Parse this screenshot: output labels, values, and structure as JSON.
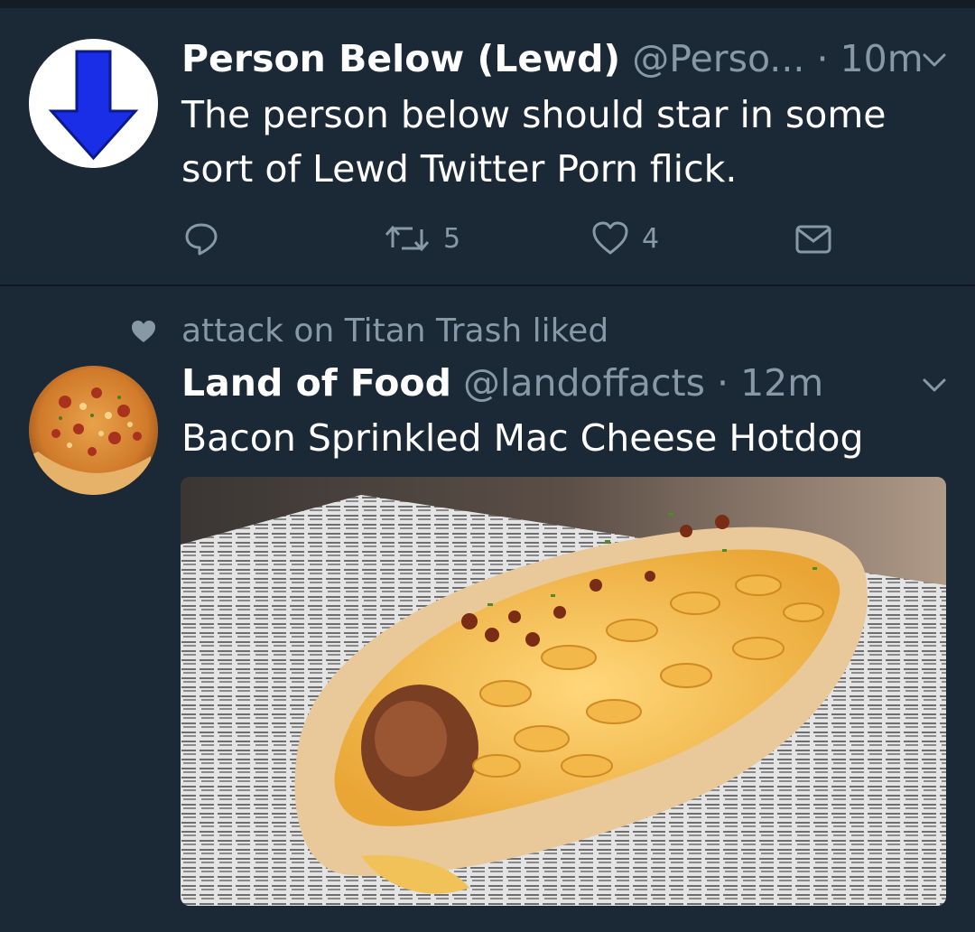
{
  "tweets": [
    {
      "display_name": "Person Below (Lewd)",
      "handle": "@Perso...",
      "separator": "·",
      "time": "10m",
      "text": "The person below should star in some sort of Lewd Twitter Porn flick.",
      "avatar_icon": "down-arrow-icon",
      "actions": {
        "reply_count": "",
        "retweet_count": "5",
        "like_count": "4"
      }
    },
    {
      "social_context": "attack on Titan Trash liked",
      "display_name": "Land of Food",
      "handle": "@landoffacts",
      "separator": "·",
      "time": "12m",
      "text": "Bacon Sprinkled Mac Cheese Hotdog",
      "avatar_icon": "pizza-photo",
      "media_description": "mac-and-cheese-hotdog-photo"
    }
  ],
  "colors": {
    "background": "#1b2836",
    "divider": "#0f1822",
    "text_primary": "#ffffff",
    "text_secondary": "#8899a6",
    "arrow_blue": "#1a2ee8"
  }
}
